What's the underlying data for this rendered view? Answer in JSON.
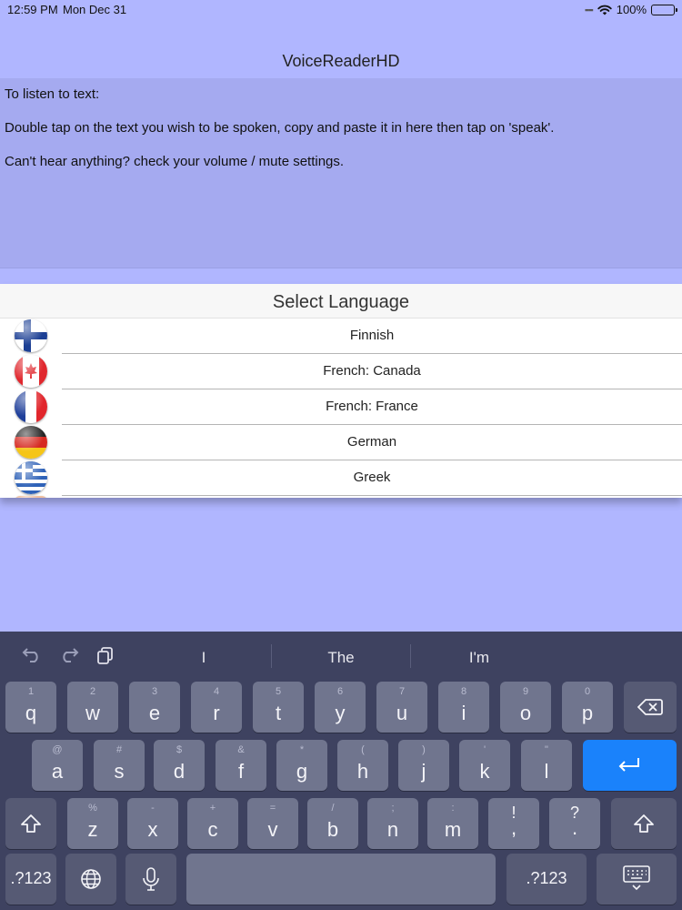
{
  "status_bar": {
    "time": "12:59 PM",
    "date": "Mon Dec 31",
    "battery": "100%"
  },
  "app": {
    "title": "VoiceReaderHD"
  },
  "text_area": {
    "line1": "To listen to text:",
    "line2": "Double tap on the text you wish to be spoken, copy and paste it in here then tap on 'speak'.",
    "line3": "Can't hear anything? check your volume / mute settings."
  },
  "picker": {
    "title": "Select Language",
    "languages": [
      "Finnish",
      "French: Canada",
      "French: France",
      "German",
      "Greek"
    ]
  },
  "keyboard": {
    "suggestions": [
      "I",
      "The",
      "I'm"
    ],
    "row1": [
      {
        "sub": "1",
        "main": "q"
      },
      {
        "sub": "2",
        "main": "w"
      },
      {
        "sub": "3",
        "main": "e"
      },
      {
        "sub": "4",
        "main": "r"
      },
      {
        "sub": "5",
        "main": "t"
      },
      {
        "sub": "6",
        "main": "y"
      },
      {
        "sub": "7",
        "main": "u"
      },
      {
        "sub": "8",
        "main": "i"
      },
      {
        "sub": "9",
        "main": "o"
      },
      {
        "sub": "0",
        "main": "p"
      }
    ],
    "row2": [
      {
        "sub": "@",
        "main": "a"
      },
      {
        "sub": "#",
        "main": "s"
      },
      {
        "sub": "$",
        "main": "d"
      },
      {
        "sub": "&",
        "main": "f"
      },
      {
        "sub": "*",
        "main": "g"
      },
      {
        "sub": "(",
        "main": "h"
      },
      {
        "sub": ")",
        "main": "j"
      },
      {
        "sub": "'",
        "main": "k"
      },
      {
        "sub": "\"",
        "main": "l"
      }
    ],
    "row3": [
      {
        "sub": "%",
        "main": "z"
      },
      {
        "sub": "-",
        "main": "x"
      },
      {
        "sub": "+",
        "main": "c"
      },
      {
        "sub": "=",
        "main": "v"
      },
      {
        "sub": "/",
        "main": "b"
      },
      {
        "sub": ";",
        "main": "n"
      },
      {
        "sub": ":",
        "main": "m"
      },
      {
        "sub": "!",
        "main": ","
      },
      {
        "sub": "?",
        "main": "."
      }
    ],
    "numbers_key": ".?123"
  },
  "colors": {
    "background": "#b0b6ff",
    "text_area": "#a5aaf0",
    "keyboard": "#3e4260",
    "return_key": "#1a82fb"
  },
  "icons": {
    "undo": "undo-icon",
    "redo": "redo-icon",
    "paste": "paste-icon",
    "delete": "delete-icon",
    "return": "return-icon",
    "shift": "shift-icon",
    "globe": "globe-icon",
    "mic": "microphone-icon",
    "dismiss": "keyboard-dismiss-icon"
  }
}
